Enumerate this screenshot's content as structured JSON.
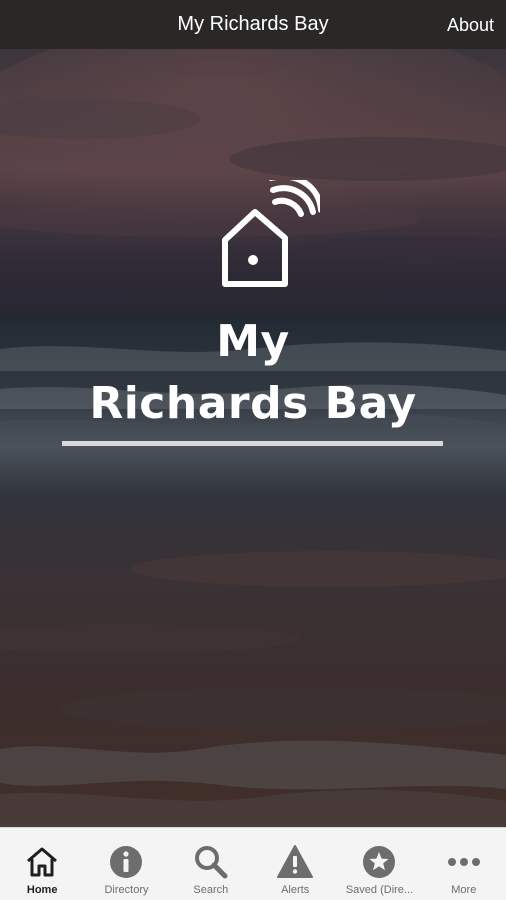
{
  "header": {
    "title": "My Richards Bay",
    "about_label": "About"
  },
  "hero": {
    "icon": "smart-home-wifi-icon",
    "title_line1": "My",
    "title_line2": "Richards Bay"
  },
  "tabs": [
    {
      "label": "Home",
      "icon": "home-icon",
      "active": true
    },
    {
      "label": "Directory",
      "icon": "info-circle-icon",
      "active": false
    },
    {
      "label": "Search",
      "icon": "search-icon",
      "active": false
    },
    {
      "label": "Alerts",
      "icon": "warning-icon",
      "active": false
    },
    {
      "label": "Saved (Dire...",
      "icon": "star-circle-icon",
      "active": false
    },
    {
      "label": "More",
      "icon": "more-dots-icon",
      "active": false
    }
  ],
  "colors": {
    "top_bar": "#2a2727",
    "tab_bar": "#f4f4f4",
    "tab_active": "#1f1f1f",
    "tab_inactive": "#6d6d6d"
  }
}
